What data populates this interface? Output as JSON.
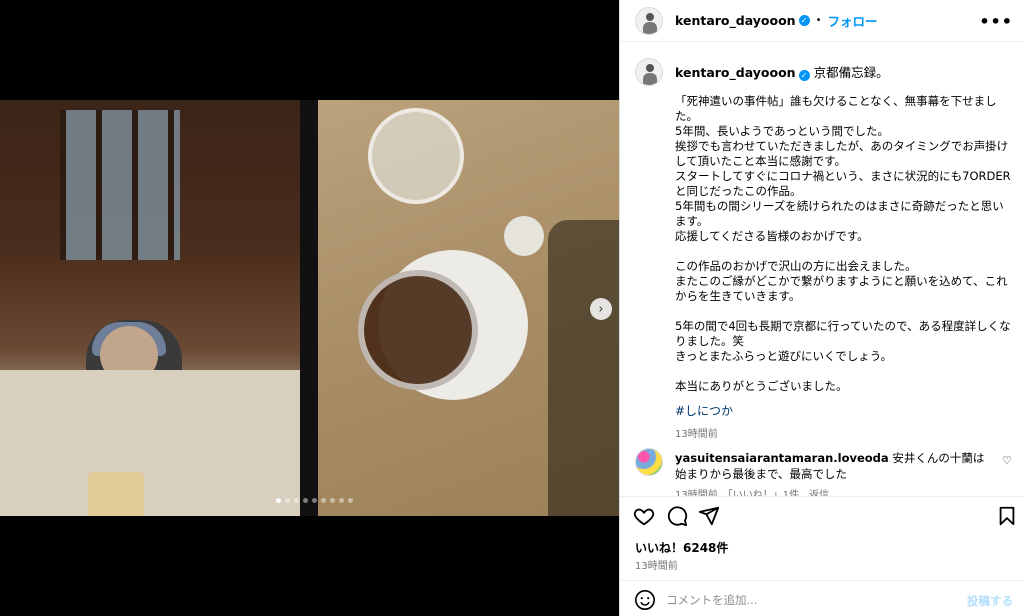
{
  "post": {
    "username": "kentaro_dayooon",
    "follow_label": "フォロー",
    "separator": "•",
    "more_label": "•••"
  },
  "caption": {
    "username": "kentaro_dayooon",
    "title": "京都備忘録。",
    "lines": [
      "「死神遣いの事件帖」誰も欠けることなく、無事幕を下せました。",
      "5年間、長いようであっという間でした。",
      "挨拶でも言わせていただきましたが、あのタイミングでお声掛けして頂いたこと本当に感謝です。",
      "スタートしてすぐにコロナ禍という、まさに状況的にも7ORDERと同じだったこの作品。",
      "5年間もの間シリーズを続けられたのはまさに奇跡だったと思います。",
      "応援してくださる皆様のおかげです。",
      "",
      "この作品のおかげで沢山の方に出会えました。",
      "またこのご縁がどこかで繋がりますようにと願いを込めて、これからを生きていきます。",
      "",
      "5年の間で4回も長期で京都に行っていたので、ある程度詳しくなりました。笑",
      "きっとまたふらっと遊びにいくでしょう。",
      "",
      "本当にありがとうございました。"
    ],
    "hashtag": "#しにつか",
    "time": "13時間前"
  },
  "comment": {
    "username": "yasuitensaiarantamaran.loveoda",
    "text": "安井くんの十蘭は始まりから最後まで、最高でした",
    "meta": "13時間前　「いいね！」1件　返信"
  },
  "stats": {
    "likes": "いいね！6248件",
    "time": "13時間前"
  },
  "comment_box": {
    "placeholder": "コメントを追加...",
    "post_label": "投稿する"
  },
  "carousel": {
    "total_slides": 9,
    "active_slide": 1
  },
  "icons": {
    "verified": "verified-badge-icon",
    "heart": "heart-icon",
    "comment": "comment-icon",
    "share": "paper-plane-icon",
    "save": "bookmark-icon",
    "emoji": "emoji-icon",
    "next": "chevron-right-icon"
  },
  "colors": {
    "accent": "#0095f6",
    "hashtag": "#00376b",
    "muted": "#737373"
  }
}
